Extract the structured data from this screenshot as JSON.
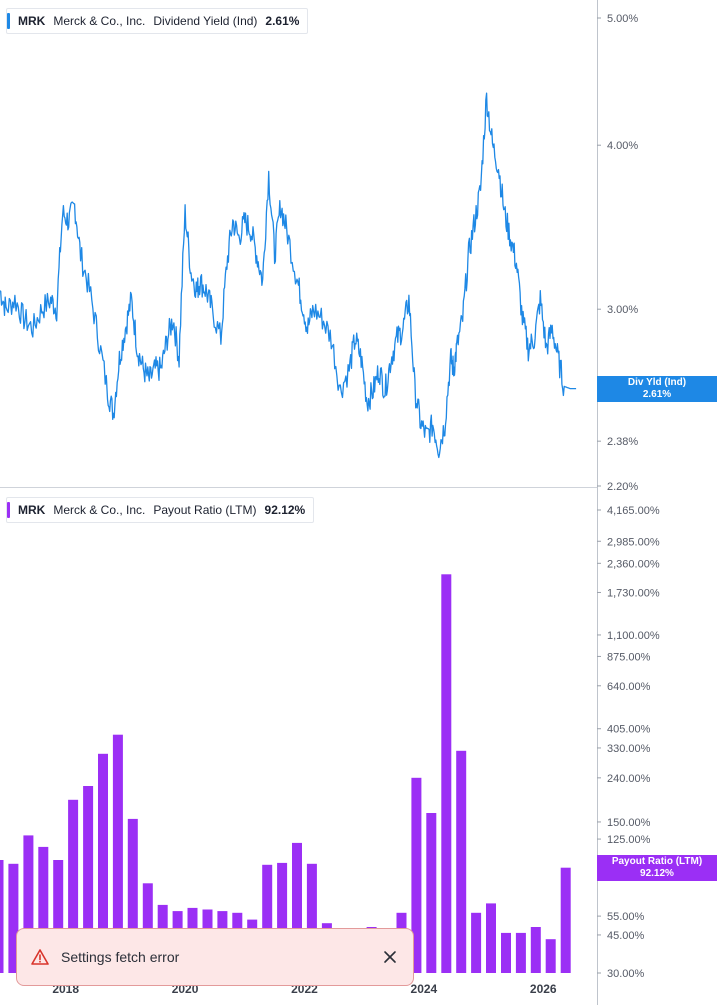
{
  "top_panel": {
    "ticker": "MRK",
    "company": "Merck & Co., Inc.",
    "metric": "Dividend Yield (Ind)",
    "value": "2.61%",
    "badge_label": "Div Yld (Ind)",
    "badge_value": "2.61%",
    "color": "#1e88e5"
  },
  "bottom_panel": {
    "ticker": "MRK",
    "company": "Merck & Co., Inc.",
    "metric": "Payout Ratio (LTM)",
    "value": "92.12%",
    "badge_label": "Payout Ratio (LTM)",
    "badge_value": "92.12%",
    "color": "#9b2ff5"
  },
  "toast": {
    "message": "Settings fetch error",
    "icon": "warning-triangle-icon",
    "close_icon": "close-icon"
  },
  "chart_data": [
    {
      "type": "line",
      "title": "MRK Merck & Co., Inc. Dividend Yield (Ind) 2.61%",
      "scale": "log",
      "ylim": [
        2.2,
        5.0
      ],
      "yticks": [
        "5.00%",
        "4.00%",
        "3.00%",
        "2.38%",
        "2.20%"
      ],
      "ytick_values": [
        5.0,
        4.0,
        3.0,
        2.38,
        2.2
      ],
      "xticks": [
        "2018",
        "2020",
        "2022",
        "2024",
        "2026"
      ],
      "xtick_values": [
        2018,
        2020,
        2022,
        2024,
        2026
      ],
      "xlim": [
        2016.9,
        2026.9
      ],
      "series": [
        {
          "x": [
            2016.9,
            2017.0,
            2017.15,
            2017.3,
            2017.45,
            2017.6,
            2017.75,
            2017.85,
            2017.95,
            2018.05,
            2018.15,
            2018.25,
            2018.4,
            2018.55,
            2018.7,
            2018.8,
            2018.9,
            2019.0,
            2019.1,
            2019.2,
            2019.3,
            2019.4,
            2019.5,
            2019.6,
            2019.7,
            2019.8,
            2019.9,
            2020.0,
            2020.1,
            2020.2,
            2020.25,
            2020.35,
            2020.45,
            2020.6,
            2020.7,
            2020.8,
            2020.9,
            2021.0,
            2021.1,
            2021.2,
            2021.3,
            2021.4,
            2021.5,
            2021.6,
            2021.7,
            2021.85,
            2021.95,
            2022.05,
            2022.15,
            2022.3,
            2022.45,
            2022.6,
            2022.75,
            2022.85,
            2022.95,
            2023.05,
            2023.15,
            2023.25,
            2023.35,
            2023.45,
            2023.55,
            2023.65,
            2023.75,
            2023.85,
            2023.95,
            2024.05,
            2024.15,
            2024.25,
            2024.35,
            2024.45,
            2024.5,
            2024.55,
            2024.65,
            2024.75,
            2024.85,
            2024.95,
            2025.05,
            2025.15,
            2025.25,
            2025.35,
            2025.45,
            2025.55,
            2025.65,
            2025.75,
            2025.85,
            2025.95,
            2026.05,
            2026.15,
            2026.25,
            2026.35,
            2026.45,
            2026.55
          ],
          "values": [
            3.1,
            3.0,
            3.05,
            2.95,
            2.9,
            3.0,
            3.05,
            3.0,
            3.55,
            3.5,
            3.6,
            3.3,
            3.1,
            2.85,
            2.6,
            2.5,
            2.75,
            2.9,
            3.05,
            2.8,
            2.7,
            2.65,
            2.7,
            2.7,
            2.85,
            2.95,
            2.75,
            3.55,
            3.2,
            3.1,
            3.15,
            3.1,
            3.0,
            2.85,
            3.25,
            3.5,
            3.4,
            3.5,
            3.45,
            3.3,
            3.15,
            3.8,
            3.3,
            3.6,
            3.45,
            3.2,
            3.05,
            2.9,
            3.0,
            2.95,
            2.85,
            2.6,
            2.7,
            2.85,
            2.75,
            2.55,
            2.6,
            2.7,
            2.6,
            2.75,
            2.85,
            2.9,
            3.05,
            2.6,
            2.45,
            2.4,
            2.45,
            2.35,
            2.45,
            2.75,
            2.7,
            2.8,
            2.95,
            3.3,
            3.5,
            3.7,
            4.35,
            4.0,
            3.85,
            3.55,
            3.4,
            3.25,
            2.95,
            2.8,
            2.85,
            3.05,
            2.8,
            2.9,
            2.75,
            2.62,
            2.61,
            2.61
          ]
        }
      ]
    },
    {
      "type": "bar",
      "title": "MRK Merck & Co., Inc. Payout Ratio (LTM) 92.12%",
      "scale": "log",
      "ylim": [
        30,
        4165
      ],
      "yticks": [
        "4,165.00%",
        "2,985.00%",
        "2,360.00%",
        "1,730.00%",
        "1,100.00%",
        "875.00%",
        "640.00%",
        "405.00%",
        "330.00%",
        "240.00%",
        "150.00%",
        "125.00%",
        "55.00%",
        "45.00%",
        "30.00%"
      ],
      "ytick_values": [
        4165,
        2985,
        2360,
        1730,
        1100,
        875,
        640,
        405,
        330,
        240,
        150,
        125,
        55,
        45,
        30
      ],
      "xticks": [
        "2018",
        "2020",
        "2022",
        "2024",
        "2026"
      ],
      "xtick_values": [
        2018,
        2020,
        2022,
        2024,
        2026
      ],
      "xlim": [
        2016.9,
        2026.9
      ],
      "x": [
        2016.875,
        2017.125,
        2017.375,
        2017.625,
        2017.875,
        2018.125,
        2018.375,
        2018.625,
        2018.875,
        2019.125,
        2019.375,
        2019.625,
        2019.875,
        2020.125,
        2020.375,
        2020.625,
        2020.875,
        2021.125,
        2021.375,
        2021.625,
        2021.875,
        2022.125,
        2022.375,
        2022.625,
        2022.875,
        2023.125,
        2023.375,
        2023.625,
        2023.875,
        2024.125,
        2024.375,
        2024.625,
        2024.875,
        2025.125,
        2025.375,
        2025.625,
        2025.875,
        2026.125,
        2026.375
      ],
      "values": [
        100,
        96,
        130,
        115,
        100,
        190,
        220,
        310,
        380,
        155,
        78,
        62,
        58,
        60,
        59,
        58,
        57,
        53,
        95,
        97,
        120,
        96,
        51,
        48,
        48,
        49,
        48,
        57,
        240,
        165,
        2100,
        320,
        57,
        63,
        46,
        46,
        49,
        43,
        92.12
      ]
    }
  ]
}
